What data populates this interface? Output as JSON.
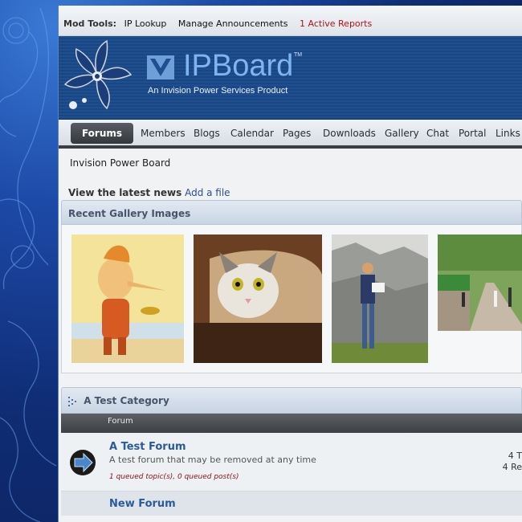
{
  "modbar": {
    "label": "Mod Tools:",
    "items": [
      "IP Lookup",
      "Manage Announcements"
    ],
    "reports": "1 Active Reports"
  },
  "header": {
    "logo_text": "IPBoard",
    "logo_tm": "TM",
    "logo_sub": "An Invision Power Services Product"
  },
  "nav": {
    "active": "Forums",
    "tabs": [
      "Members",
      "Blogs",
      "Calendar",
      "Pages",
      "Downloads",
      "Gallery",
      "Chat",
      "Portal",
      "Links"
    ]
  },
  "breadcrumb": "Invision Power Board",
  "news": {
    "label": "View the latest news",
    "link": "Add a file"
  },
  "gallery": {
    "title": "Recent Gallery Images"
  },
  "category": {
    "title": "A Test Category",
    "column": "Forum",
    "forums": [
      {
        "title": "A Test Forum",
        "description": "A test forum that may be removed at any time",
        "queued": "1 queued topic(s), 0 queued post(s)",
        "stats": [
          "4 T",
          "4 Re"
        ]
      },
      {
        "title": "New Forum"
      }
    ]
  },
  "colors": {
    "accent": "#2b5a9c",
    "header_bg": "#1f4f8f",
    "reports": "#b0121a"
  }
}
